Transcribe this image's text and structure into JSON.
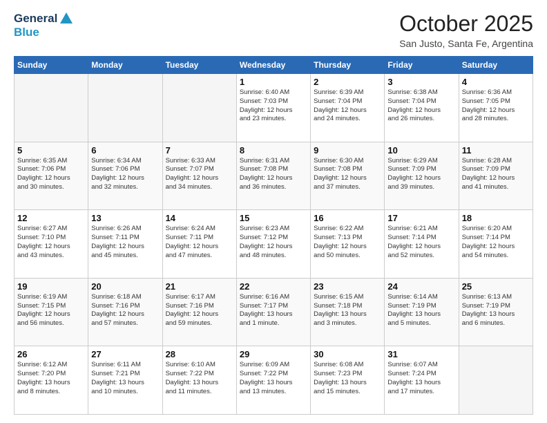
{
  "header": {
    "logo_line1": "General",
    "logo_line2": "Blue",
    "month": "October 2025",
    "location": "San Justo, Santa Fe, Argentina"
  },
  "days_of_week": [
    "Sunday",
    "Monday",
    "Tuesday",
    "Wednesday",
    "Thursday",
    "Friday",
    "Saturday"
  ],
  "weeks": [
    [
      {
        "day": "",
        "text": ""
      },
      {
        "day": "",
        "text": ""
      },
      {
        "day": "",
        "text": ""
      },
      {
        "day": "1",
        "text": "Sunrise: 6:40 AM\nSunset: 7:03 PM\nDaylight: 12 hours\nand 23 minutes."
      },
      {
        "day": "2",
        "text": "Sunrise: 6:39 AM\nSunset: 7:04 PM\nDaylight: 12 hours\nand 24 minutes."
      },
      {
        "day": "3",
        "text": "Sunrise: 6:38 AM\nSunset: 7:04 PM\nDaylight: 12 hours\nand 26 minutes."
      },
      {
        "day": "4",
        "text": "Sunrise: 6:36 AM\nSunset: 7:05 PM\nDaylight: 12 hours\nand 28 minutes."
      }
    ],
    [
      {
        "day": "5",
        "text": "Sunrise: 6:35 AM\nSunset: 7:06 PM\nDaylight: 12 hours\nand 30 minutes."
      },
      {
        "day": "6",
        "text": "Sunrise: 6:34 AM\nSunset: 7:06 PM\nDaylight: 12 hours\nand 32 minutes."
      },
      {
        "day": "7",
        "text": "Sunrise: 6:33 AM\nSunset: 7:07 PM\nDaylight: 12 hours\nand 34 minutes."
      },
      {
        "day": "8",
        "text": "Sunrise: 6:31 AM\nSunset: 7:08 PM\nDaylight: 12 hours\nand 36 minutes."
      },
      {
        "day": "9",
        "text": "Sunrise: 6:30 AM\nSunset: 7:08 PM\nDaylight: 12 hours\nand 37 minutes."
      },
      {
        "day": "10",
        "text": "Sunrise: 6:29 AM\nSunset: 7:09 PM\nDaylight: 12 hours\nand 39 minutes."
      },
      {
        "day": "11",
        "text": "Sunrise: 6:28 AM\nSunset: 7:09 PM\nDaylight: 12 hours\nand 41 minutes."
      }
    ],
    [
      {
        "day": "12",
        "text": "Sunrise: 6:27 AM\nSunset: 7:10 PM\nDaylight: 12 hours\nand 43 minutes."
      },
      {
        "day": "13",
        "text": "Sunrise: 6:26 AM\nSunset: 7:11 PM\nDaylight: 12 hours\nand 45 minutes."
      },
      {
        "day": "14",
        "text": "Sunrise: 6:24 AM\nSunset: 7:11 PM\nDaylight: 12 hours\nand 47 minutes."
      },
      {
        "day": "15",
        "text": "Sunrise: 6:23 AM\nSunset: 7:12 PM\nDaylight: 12 hours\nand 48 minutes."
      },
      {
        "day": "16",
        "text": "Sunrise: 6:22 AM\nSunset: 7:13 PM\nDaylight: 12 hours\nand 50 minutes."
      },
      {
        "day": "17",
        "text": "Sunrise: 6:21 AM\nSunset: 7:14 PM\nDaylight: 12 hours\nand 52 minutes."
      },
      {
        "day": "18",
        "text": "Sunrise: 6:20 AM\nSunset: 7:14 PM\nDaylight: 12 hours\nand 54 minutes."
      }
    ],
    [
      {
        "day": "19",
        "text": "Sunrise: 6:19 AM\nSunset: 7:15 PM\nDaylight: 12 hours\nand 56 minutes."
      },
      {
        "day": "20",
        "text": "Sunrise: 6:18 AM\nSunset: 7:16 PM\nDaylight: 12 hours\nand 57 minutes."
      },
      {
        "day": "21",
        "text": "Sunrise: 6:17 AM\nSunset: 7:16 PM\nDaylight: 12 hours\nand 59 minutes."
      },
      {
        "day": "22",
        "text": "Sunrise: 6:16 AM\nSunset: 7:17 PM\nDaylight: 13 hours\nand 1 minute."
      },
      {
        "day": "23",
        "text": "Sunrise: 6:15 AM\nSunset: 7:18 PM\nDaylight: 13 hours\nand 3 minutes."
      },
      {
        "day": "24",
        "text": "Sunrise: 6:14 AM\nSunset: 7:19 PM\nDaylight: 13 hours\nand 5 minutes."
      },
      {
        "day": "25",
        "text": "Sunrise: 6:13 AM\nSunset: 7:19 PM\nDaylight: 13 hours\nand 6 minutes."
      }
    ],
    [
      {
        "day": "26",
        "text": "Sunrise: 6:12 AM\nSunset: 7:20 PM\nDaylight: 13 hours\nand 8 minutes."
      },
      {
        "day": "27",
        "text": "Sunrise: 6:11 AM\nSunset: 7:21 PM\nDaylight: 13 hours\nand 10 minutes."
      },
      {
        "day": "28",
        "text": "Sunrise: 6:10 AM\nSunset: 7:22 PM\nDaylight: 13 hours\nand 11 minutes."
      },
      {
        "day": "29",
        "text": "Sunrise: 6:09 AM\nSunset: 7:22 PM\nDaylight: 13 hours\nand 13 minutes."
      },
      {
        "day": "30",
        "text": "Sunrise: 6:08 AM\nSunset: 7:23 PM\nDaylight: 13 hours\nand 15 minutes."
      },
      {
        "day": "31",
        "text": "Sunrise: 6:07 AM\nSunset: 7:24 PM\nDaylight: 13 hours\nand 17 minutes."
      },
      {
        "day": "",
        "text": ""
      }
    ]
  ]
}
